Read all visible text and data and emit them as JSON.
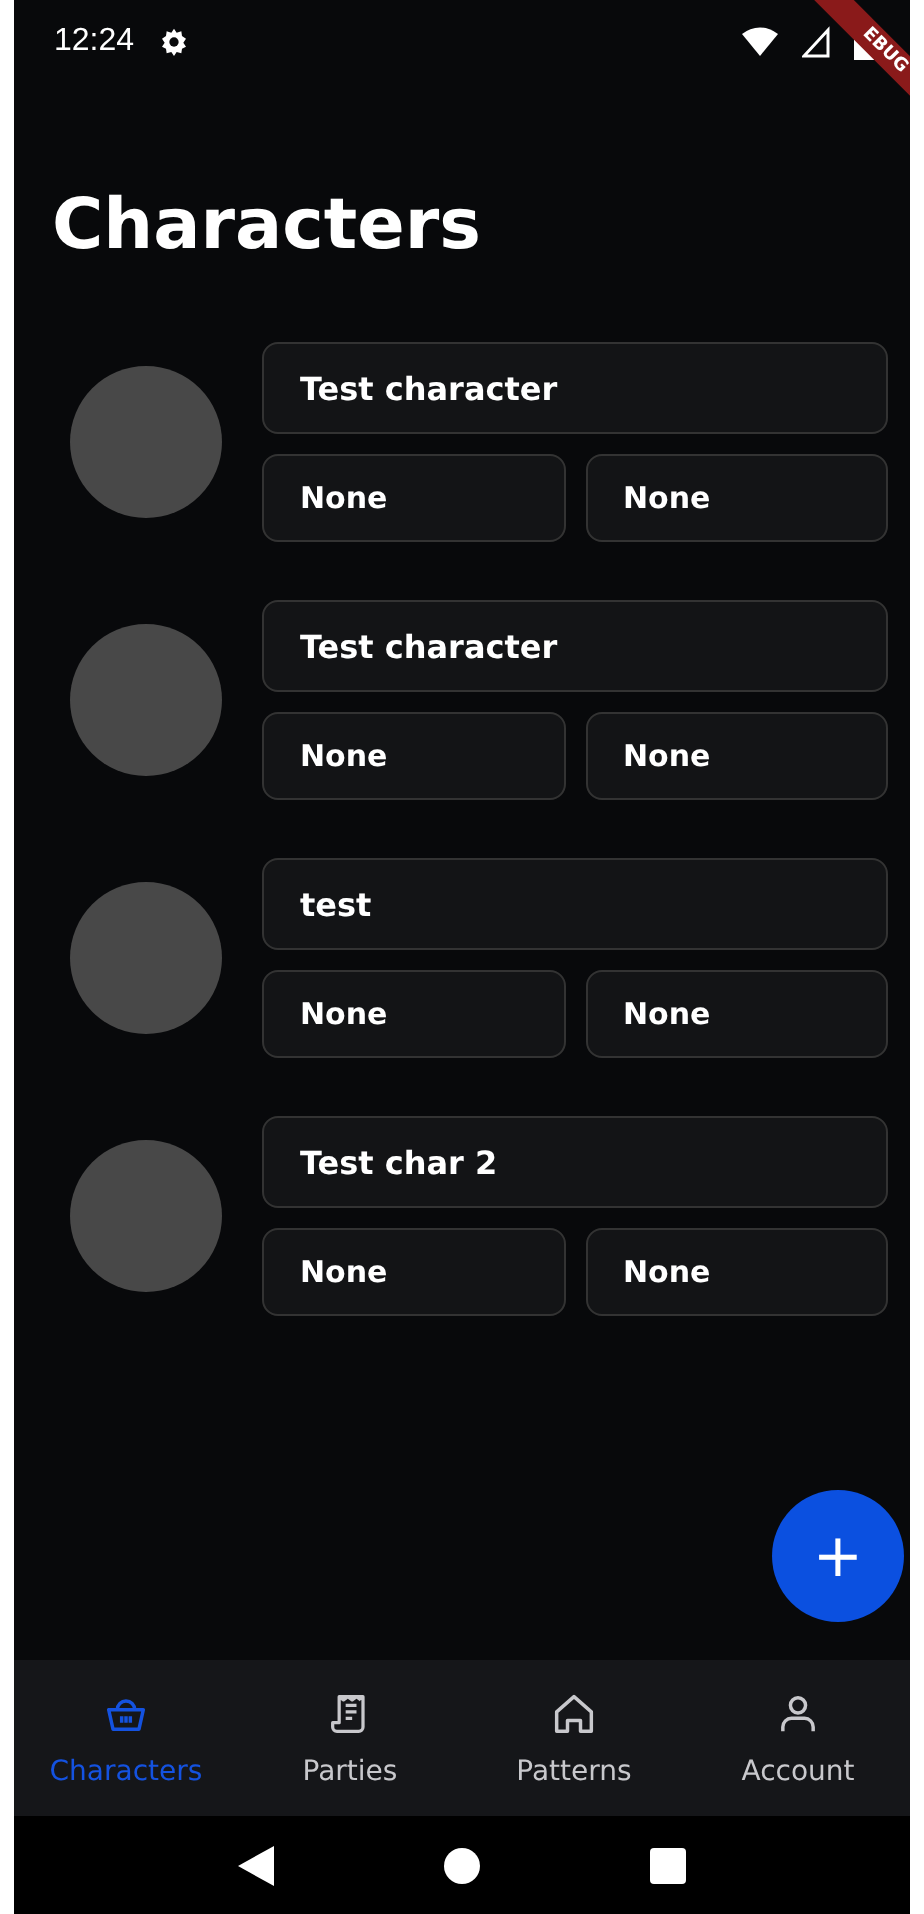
{
  "status_bar": {
    "time": "12:24",
    "debug_banner": "EBUG"
  },
  "title": "Characters",
  "characters": [
    {
      "name": "Test character",
      "field_1": "None",
      "field_2": "None"
    },
    {
      "name": "Test character",
      "field_1": "None",
      "field_2": "None"
    },
    {
      "name": "test",
      "field_1": "None",
      "field_2": "None"
    },
    {
      "name": "Test char 2",
      "field_1": "None",
      "field_2": "None"
    }
  ],
  "fab": {
    "label": "+"
  },
  "bottom_nav": [
    {
      "label": "Characters",
      "selected": true
    },
    {
      "label": "Parties",
      "selected": false
    },
    {
      "label": "Patterns",
      "selected": false
    },
    {
      "label": "Account",
      "selected": false
    }
  ]
}
